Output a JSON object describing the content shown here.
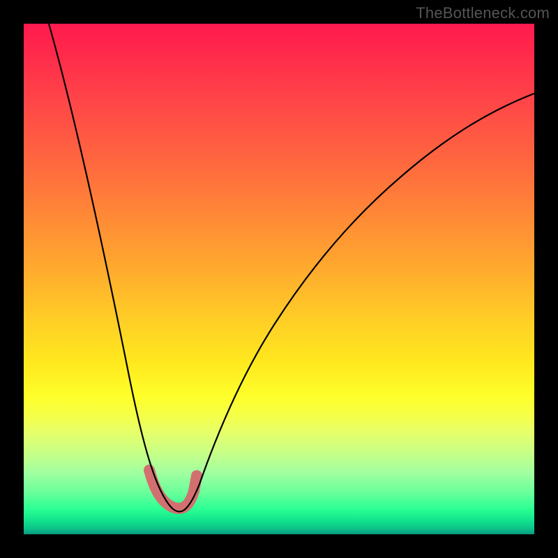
{
  "watermark": "TheBottleneck.com",
  "chart_data": {
    "type": "line",
    "title": "",
    "xlabel": "",
    "ylabel": "",
    "xlim": [
      0,
      100
    ],
    "ylim": [
      0,
      100
    ],
    "grid": false,
    "legend": false,
    "series": [
      {
        "name": "bottleneck-curve",
        "x": [
          5,
          8,
          11,
          14,
          17,
          20,
          22,
          24,
          26,
          28,
          30,
          32,
          35,
          40,
          45,
          50,
          55,
          60,
          65,
          70,
          75,
          80,
          85,
          90,
          95,
          100
        ],
        "y": [
          100,
          87,
          74,
          61,
          48,
          36,
          27,
          19,
          12,
          8,
          5,
          8,
          14,
          24,
          33,
          41,
          48,
          54,
          60,
          65,
          69,
          73,
          76,
          78,
          80,
          82
        ]
      }
    ],
    "highlight": {
      "name": "optimal-region",
      "x_range": [
        25,
        32
      ],
      "y_range": [
        5,
        12
      ]
    },
    "color_scale": {
      "top": "#ff1a4f",
      "mid": "#ffe71e",
      "bottom": "#089a82"
    }
  }
}
